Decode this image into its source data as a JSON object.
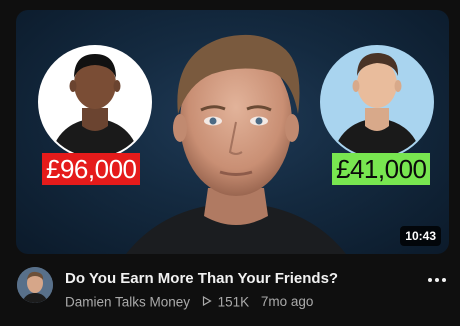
{
  "video": {
    "thumbnail": {
      "left_figure": {
        "salary_label": "£96,000"
      },
      "right_figure": {
        "salary_label": "£41,000"
      },
      "duration": "10:43",
      "colors": {
        "left_tag_bg": "#e51b1b",
        "right_tag_bg": "#78e650"
      }
    },
    "title": "Do You Earn More Than Your Friends?",
    "channel_name": "Damien Talks Money",
    "views": "151K",
    "age": "7mo ago",
    "icons": {
      "channel_avatar": "avatar",
      "views_icon": "play-triangle-icon",
      "menu": "more-vert-icon"
    }
  }
}
